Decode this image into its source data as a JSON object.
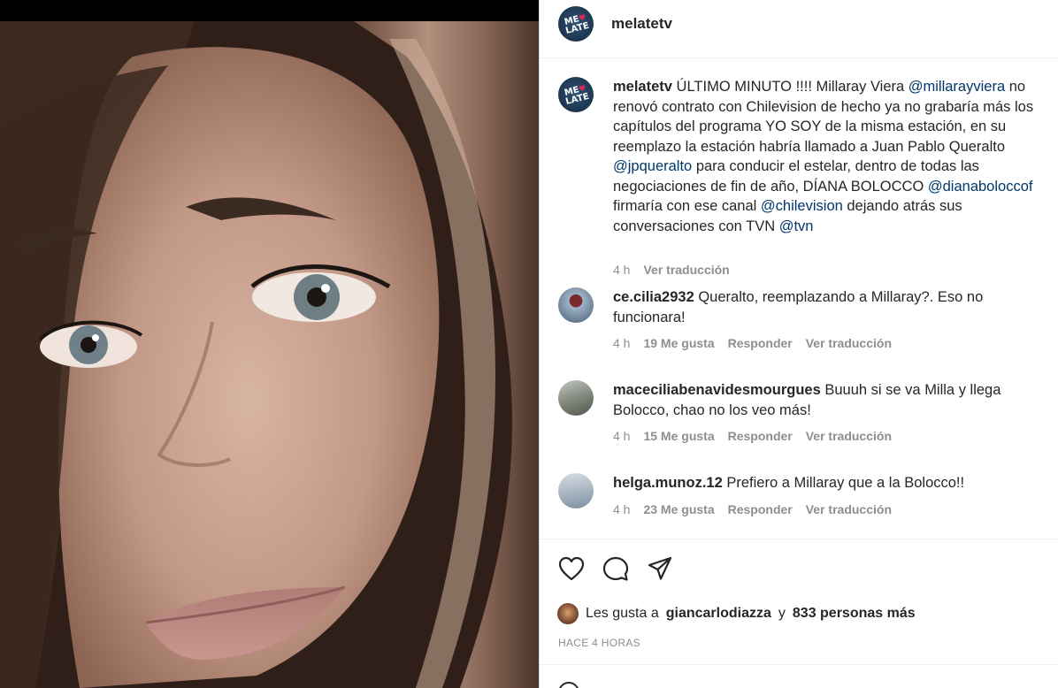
{
  "post": {
    "username": "melatetv",
    "avatar_text": "ME LATE",
    "caption": {
      "user": "melatetv",
      "segments": [
        {
          "t": "ÚLTIMO MINUTO !!!! Millaray Viera "
        },
        {
          "t": "@millarayviera",
          "mention": true
        },
        {
          "t": " no renovó contrato con Chilevision de hecho ya no grabaría más los capítulos del programa YO SOY de la misma estación, en su reemplazo la estación habría llamado a Juan Pablo Queralto "
        },
        {
          "t": "@jpqueralto",
          "mention": true
        },
        {
          "t": " para conducir el estelar, dentro de todas las negociaciones de fin de año, DÍANA BOLOCCO "
        },
        {
          "t": "@dianaboloccof",
          "mention": true
        },
        {
          "t": " firmaría con ese canal "
        },
        {
          "t": "@chilevision",
          "mention": true
        },
        {
          "t": " dejando atrás sus conversaciones con TVN "
        },
        {
          "t": "@tvn",
          "mention": true
        }
      ],
      "time": "4 h",
      "translate": "Ver traducción"
    },
    "comments": [
      {
        "user": "ce.cilia2932",
        "text": "Queralto, reemplazando a Millaray?. Eso no funcionara!",
        "time": "4 h",
        "likes": "19 Me gusta",
        "reply": "Responder",
        "translate": "Ver traducción"
      },
      {
        "user": "maceciliabenavidesmourgues",
        "text": "Buuuh si se va Milla y llega Bolocco, chao no los veo más!",
        "time": "4 h",
        "likes": "15 Me gusta",
        "reply": "Responder",
        "translate": "Ver traducción"
      },
      {
        "user": "helga.munoz.12",
        "text": "Prefiero a Millaray que a la Bolocco!!",
        "time": "4 h",
        "likes": "23 Me gusta",
        "reply": "Responder",
        "translate": "Ver traducción"
      }
    ],
    "actions": {
      "like_icon": "heart-icon",
      "comment_icon": "comment-icon",
      "share_icon": "share-icon"
    },
    "liked_by": {
      "prefix": "Les gusta a",
      "user": "giancarlodiazza",
      "joiner": "y",
      "others": "833 personas más"
    },
    "posted_ago": "HACE 4 HORAS"
  },
  "colors": {
    "mention": "#00376b",
    "meta": "#8e8e8e",
    "text": "#262626",
    "divider": "#efefef"
  }
}
